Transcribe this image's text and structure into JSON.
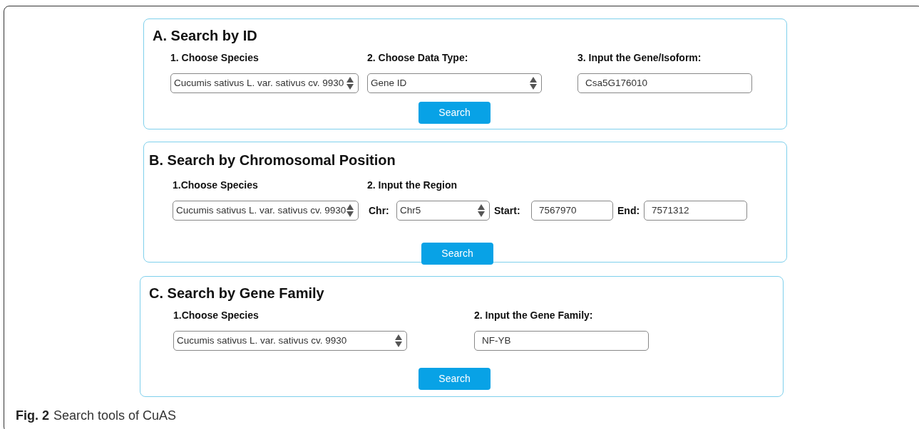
{
  "sections": [
    {
      "title": "A. Search by ID",
      "columns": [
        {
          "label": "1. Choose Species",
          "controls": [
            {
              "kind": "select",
              "value": "Cucumis sativus L. var. sativus cv. 9930"
            }
          ]
        },
        {
          "label": "2. Choose Data Type:",
          "controls": [
            {
              "kind": "select",
              "value": "Gene ID"
            }
          ]
        },
        {
          "label": "3. Input the Gene/Isoform:",
          "controls": [
            {
              "kind": "input",
              "value": "Csa5G176010"
            }
          ]
        }
      ],
      "button": "Search"
    },
    {
      "title": "B. Search by Chromosomal Position",
      "columns": [
        {
          "label": "1.Choose Species",
          "controls": [
            {
              "kind": "select",
              "value": "Cucumis sativus L. var. sativus cv. 9930"
            }
          ]
        },
        {
          "label": "2. Input the Region",
          "controls": [
            {
              "kind": "label",
              "value": "Chr:"
            },
            {
              "kind": "select",
              "value": "Chr5"
            },
            {
              "kind": "label",
              "value": "Start:"
            },
            {
              "kind": "input",
              "value": "7567970"
            },
            {
              "kind": "label",
              "value": "End:"
            },
            {
              "kind": "input",
              "value": "7571312"
            }
          ]
        }
      ],
      "button": "Search"
    },
    {
      "title": "C. Search by Gene Family",
      "columns": [
        {
          "label": "1.Choose Species",
          "controls": [
            {
              "kind": "select",
              "value": "Cucumis sativus L. var. sativus cv. 9930"
            }
          ]
        },
        {
          "label": "2. Input the Gene Family:",
          "controls": [
            {
              "kind": "input",
              "value": "NF-YB"
            }
          ]
        }
      ],
      "button": "Search"
    }
  ],
  "caption": {
    "label": "Fig. 2",
    "text": "Search tools of CuAS"
  }
}
